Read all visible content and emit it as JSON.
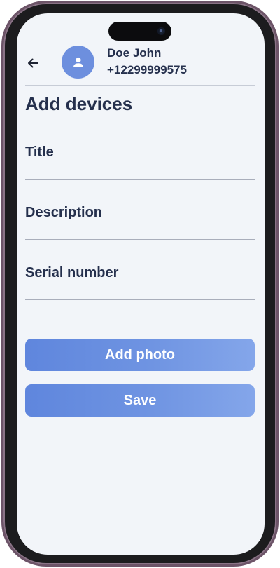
{
  "header": {
    "back_icon": "arrow-left-icon",
    "avatar_icon": "person-icon",
    "user_name": "Doe John",
    "user_phone": "+12299999575"
  },
  "page": {
    "title": "Add devices"
  },
  "form": {
    "fields": [
      {
        "label": "Title",
        "value": ""
      },
      {
        "label": "Description",
        "value": ""
      },
      {
        "label": "Serial number",
        "value": ""
      }
    ]
  },
  "actions": {
    "add_photo_label": "Add photo",
    "save_label": "Save"
  },
  "colors": {
    "accent": "#6d8fde",
    "text": "#25304d",
    "background": "#f2f5f9",
    "frame": "#6d5468"
  }
}
